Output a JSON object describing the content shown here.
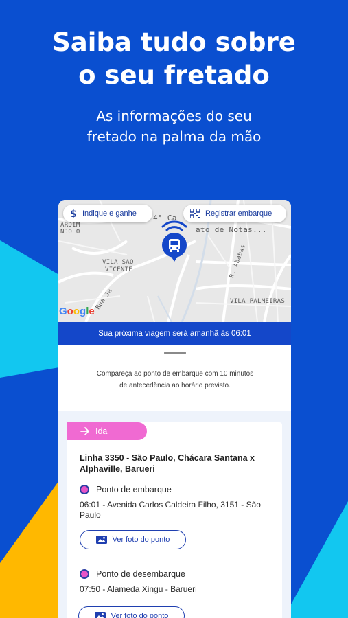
{
  "promo": {
    "headline_line1": "Saiba tudo sobre",
    "headline_line2": "o seu fretado",
    "sub_line1": "As informações do seu",
    "sub_line2": "fretado na palma da mão"
  },
  "map": {
    "chips": {
      "indique": "Indique e ganhe",
      "registrar": "Registrar embarque"
    },
    "labels": {
      "top_fragment": "4° Ca",
      "notas": "ato de Notas...",
      "ardim": "ARDIM",
      "njolo": "NJOLO",
      "vila_sao": "VILA SAO",
      "vicente": "VICENTE",
      "rua": "Rua Ja",
      "ababas": "R. Ababas",
      "vila_palmeiras": "VILA PALMEIRAS"
    },
    "google": "Google",
    "icons": {
      "indique": "dollar-icon",
      "registrar": "qr-code-icon",
      "pin": "bus-icon"
    }
  },
  "trip": {
    "banner": "Sua próxima viagem será amanhã às 06:01",
    "notice_line1": "Compareça ao ponto de embarque com 10 minutos",
    "notice_line2": "de antecedência ao horário previsto."
  },
  "route": {
    "direction": "Ida",
    "line_title": "Linha 3350 - São Paulo, Chácara Santana x Alphaville, Barueri",
    "boarding": {
      "title": "Ponto de embarque",
      "detail": "06:01 - Avenida Carlos Caldeira Filho, 3151 - São Paulo",
      "button": "Ver foto do ponto"
    },
    "alighting": {
      "title": "Ponto de desembarque",
      "detail": "07:50 - Alameda Xingu - Barueri",
      "button": "Ver foto do ponto"
    }
  },
  "colors": {
    "background": "#0a4fd0",
    "accent_cyan": "#12c7f0",
    "accent_yellow": "#ffb800",
    "banner": "#1447c9",
    "pink": "#f06ad2",
    "brand_blue": "#1f3fb0"
  }
}
